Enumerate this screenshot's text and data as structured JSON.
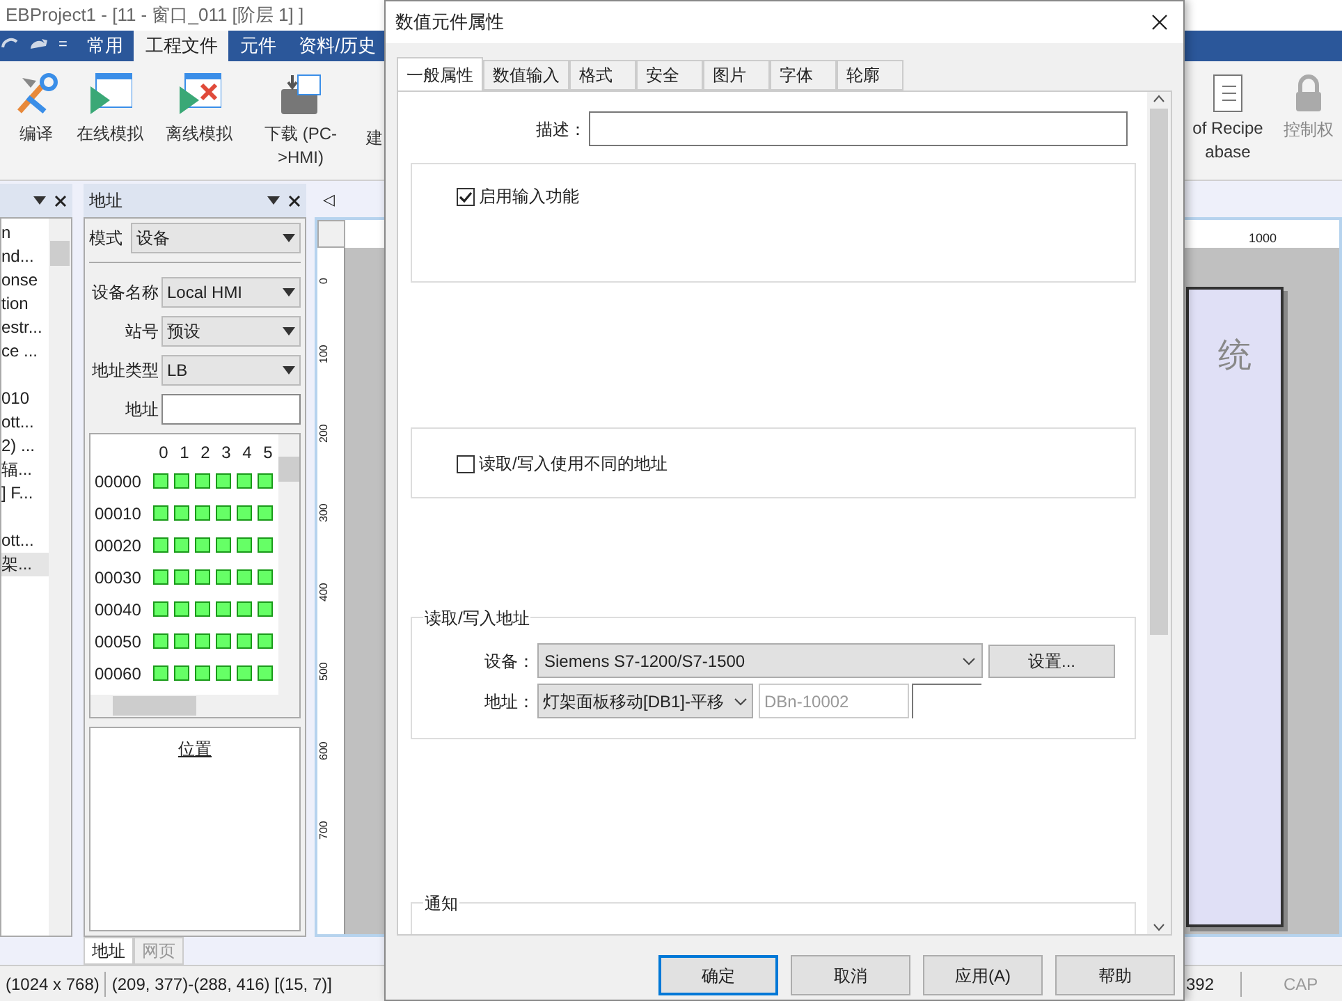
{
  "app": {
    "title": "EBProject1 - [11 - 窗口_011 [阶层 1] ]",
    "quick_access": {
      "menu": "="
    },
    "ribbon_tabs": [
      {
        "label": "常用",
        "selected": false
      },
      {
        "label": "工程文件",
        "selected": true
      },
      {
        "label": "元件",
        "selected": false
      },
      {
        "label": "资料/历史",
        "selected": false
      }
    ],
    "ribbon_buttons": [
      {
        "kind": "compile",
        "label": "编译"
      },
      {
        "kind": "online",
        "label": "在线模拟"
      },
      {
        "kind": "offline",
        "label": "离线模拟"
      },
      {
        "kind": "download",
        "label": "下载 (PC->HMI)"
      },
      {
        "kind": "cut",
        "label": "建"
      }
    ],
    "ribbon_right": [
      {
        "kind": "recipe",
        "label": "of Recipe abase"
      },
      {
        "kind": "lock",
        "label": "控制权"
      }
    ]
  },
  "tree_panel": {
    "groups": [
      [
        {
          "label": "n",
          "selected": false
        },
        {
          "label": "nd...",
          "selected": false
        },
        {
          "label": "onse",
          "selected": false
        },
        {
          "label": "tion",
          "selected": false
        },
        {
          "label": "estr...",
          "selected": false
        },
        {
          "label": "ce ...",
          "selected": false
        }
      ],
      [
        {
          "label": "010",
          "selected": false
        },
        {
          "label": "ott...",
          "selected": false
        },
        {
          "label": "2) ...",
          "selected": false
        },
        {
          "label": "辐...",
          "selected": false
        },
        {
          "label": "] F...",
          "selected": false
        }
      ],
      [
        {
          "label": "ott...",
          "selected": false
        },
        {
          "label": "架...",
          "selected": true
        }
      ]
    ]
  },
  "address_panel": {
    "title": "地址",
    "fields": [
      {
        "kind": "select",
        "label": "模式",
        "value": "设备"
      },
      {
        "kind": "select",
        "label": "设备名称",
        "value": "Local HMI"
      },
      {
        "kind": "select",
        "label": "站号",
        "value": "预设"
      },
      {
        "kind": "select",
        "label": "地址类型",
        "value": "LB"
      },
      {
        "kind": "input",
        "label": "地址"
      }
    ],
    "bit_columns": [
      "0",
      "1",
      "2",
      "3",
      "4",
      "5"
    ],
    "bit_rows": [
      "00000",
      "00010",
      "00020",
      "00030",
      "00040",
      "00050",
      "00060"
    ],
    "location_title": "位置",
    "tabs": [
      {
        "label": "地址",
        "selected": true
      },
      {
        "label": "网页",
        "selected": false
      }
    ]
  },
  "canvas": {
    "tab_arrow": "◁",
    "vertical_ruler": [
      "0",
      "100",
      "200",
      "300",
      "400",
      "500",
      "600",
      "700"
    ],
    "horizontal_ruler": [
      "1000"
    ],
    "window_text": "统"
  },
  "status_bar": [
    "(1024 x 768)",
    "(209, 377)-(288, 416) [(15, 7)]",
    "392",
    "CAP"
  ],
  "dialog": {
    "title": "数值元件属性",
    "tabs": [
      {
        "label": "一般属性",
        "selected": true
      },
      {
        "label": "数值输入",
        "selected": false
      },
      {
        "label": "格式",
        "selected": false
      },
      {
        "label": "安全",
        "selected": false
      },
      {
        "label": "图片",
        "selected": false
      },
      {
        "label": "字体",
        "selected": false
      },
      {
        "label": "轮廓",
        "selected": false
      }
    ],
    "description_label": "描述：",
    "enable_input": {
      "label": "启用输入功能",
      "checked": true
    },
    "different_address": {
      "label": "读取/写入使用不同的地址",
      "checked": false
    },
    "rw_group": {
      "title": "读取/写入地址",
      "device_label": "设备：",
      "device": "Siemens S7-1200/S7-1500",
      "settings_button": "设置...",
      "address_label": "地址：",
      "address_tag": "灯架面板移动[DB1]-平移",
      "address_value": "DBn-10002"
    },
    "notify_title": "通知",
    "buttons": [
      {
        "label": "确定",
        "focused": true
      },
      {
        "label": "取消",
        "focused": false
      },
      {
        "label": "应用(A)",
        "focused": false
      },
      {
        "label": "帮助",
        "focused": false
      }
    ]
  }
}
